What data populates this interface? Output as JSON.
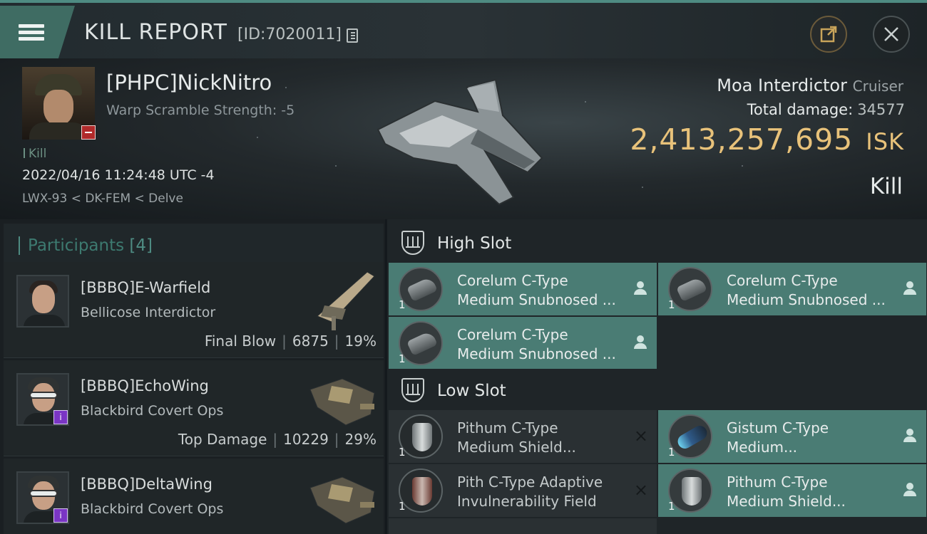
{
  "header": {
    "title": "KILL REPORT",
    "report_id": "[ID:7020011]"
  },
  "victim": {
    "name": "[PHPC]NickNitro",
    "scramble": "Warp Scramble Strength: -5",
    "tag": "Kill",
    "timestamp": "2022/04/16 11:24:48 UTC -4",
    "location": "LWX-93 < DK-FEM < Delve"
  },
  "ship": {
    "name": "Moa Interdictor",
    "class": "Cruiser",
    "damage_label": "Total damage:",
    "damage_value": "34577",
    "isk_value": "2,413,257,695",
    "isk_unit": "ISK",
    "result": "Kill"
  },
  "participants": {
    "title": "Participants",
    "count": "[4]",
    "items": [
      {
        "name": "[BBBQ]E-Warfield",
        "ship": "Bellicose Interdictor",
        "role": "Final Blow",
        "damage": "6875",
        "pct": "19%"
      },
      {
        "name": "[BBBQ]EchoWing",
        "ship": "Blackbird Covert Ops",
        "role": "Top Damage",
        "damage": "10229",
        "pct": "29%"
      },
      {
        "name": "[BBBQ]DeltaWing",
        "ship": "Blackbird Covert Ops"
      }
    ]
  },
  "high_slot": {
    "title": "High Slot",
    "modules": [
      {
        "qty": "1",
        "line1": "Corelum C-Type",
        "line2": "Medium Snubnosed ..."
      },
      {
        "qty": "1",
        "line1": "Corelum C-Type",
        "line2": "Medium Snubnosed ..."
      },
      {
        "qty": "1",
        "line1": "Corelum C-Type",
        "line2": "Medium Snubnosed ..."
      }
    ]
  },
  "low_slot": {
    "title": "Low Slot",
    "modules": [
      {
        "qty": "1",
        "line1": "Pithum C-Type",
        "line2": "Medium Shield...",
        "status": "×"
      },
      {
        "qty": "1",
        "line1": "Gistum C-Type",
        "line2": "Medium..."
      },
      {
        "qty": "1",
        "line1": "Pith C-Type Adaptive",
        "line2": "Invulnerability Field",
        "status": "×"
      },
      {
        "qty": "1",
        "line1": "Pithum C-Type",
        "line2": "Medium Shield..."
      }
    ]
  },
  "colors": {
    "accent": "#4e8b82",
    "isk": "#e8c27a",
    "module_bg": "#4a7c74",
    "module_destroyed_bg": "#2a3033"
  }
}
